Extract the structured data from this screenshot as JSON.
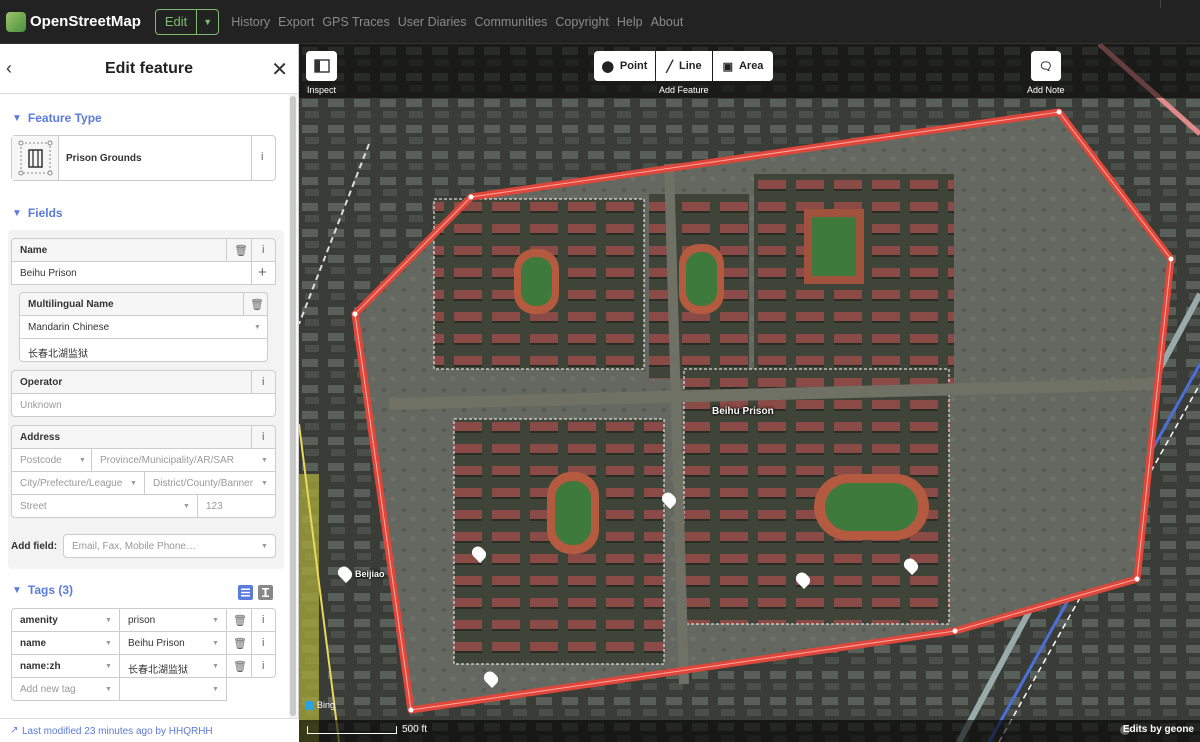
{
  "topbar": {
    "brand": "OpenStreetMap",
    "edit_label": "Edit",
    "nav": [
      "History",
      "Export",
      "GPS Traces",
      "User Diaries",
      "Communities",
      "Copyright",
      "Help",
      "About"
    ]
  },
  "sidebar": {
    "title": "Edit feature",
    "feature_type": {
      "heading": "Feature Type",
      "preset_name": "Prison Grounds"
    },
    "fields": {
      "heading": "Fields",
      "name": {
        "label": "Name",
        "value": "Beihu Prison"
      },
      "multilingual": {
        "label": "Multilingual Name",
        "language": "Mandarin Chinese",
        "value": "长春北湖监狱"
      },
      "operator": {
        "label": "Operator",
        "placeholder": "Unknown"
      },
      "address": {
        "label": "Address",
        "postcode": "Postcode",
        "province": "Province/Municipality/AR/SAR",
        "city": "City/Prefecture/League",
        "district": "District/County/Banner",
        "street": "Street",
        "housenumber": "123"
      },
      "add_field_label": "Add field:",
      "add_field_placeholder": "Email, Fax, Mobile Phone…"
    },
    "tags": {
      "heading": "Tags (3)",
      "rows": [
        {
          "key": "amenity",
          "value": "prison"
        },
        {
          "key": "name",
          "value": "Beihu Prison"
        },
        {
          "key": "name:zh",
          "value": "长春北湖监狱"
        }
      ],
      "new_tag_placeholder": "Add new tag"
    },
    "footer": "Last modified 23 minutes ago by HHQRHH"
  },
  "map": {
    "toolbar": {
      "inspect": "Inspect",
      "point": "Point",
      "line": "Line",
      "area": "Area",
      "add_feature": "Add Feature",
      "add_note": "Add Note"
    },
    "labels": {
      "prison": "Beihu Prison",
      "beijiao": "Beijiao"
    },
    "bing": "Bing",
    "scale": "500 ft",
    "attribution": "Edits by geone"
  },
  "colors": {
    "accent_blue": "#5b7bdb",
    "osm_green": "#7ebc6f",
    "selection_red": "#e0463a"
  }
}
